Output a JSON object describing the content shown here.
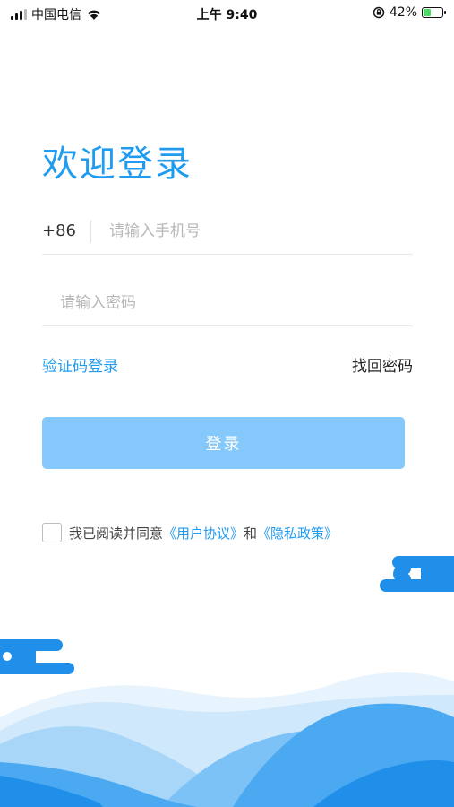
{
  "status_bar": {
    "carrier": "中国电信",
    "time": "上午 9:40",
    "battery_percent": "42%",
    "battery_level": 0.42,
    "icons": [
      "signal-icon",
      "wifi-icon",
      "orientation-lock-icon",
      "battery-icon"
    ]
  },
  "login": {
    "title": "欢迎登录",
    "country_code": "+86",
    "phone_placeholder": "请输入手机号",
    "password_placeholder": "请输入密码",
    "code_login_link": "验证码登录",
    "forgot_password_link": "找回密码",
    "login_button": "登录"
  },
  "agreement": {
    "prefix": "我已阅读并同意",
    "user_agreement": "《用户协议》",
    "conjunction": "和",
    "privacy_policy": "《隐私政策》",
    "checked": false
  },
  "colors": {
    "accent": "#1f9bef",
    "button": "#85c8fb",
    "wave_light": "#cfe8fb",
    "wave_mid": "#7cc2f7",
    "wave_dark": "#1f8fea"
  }
}
